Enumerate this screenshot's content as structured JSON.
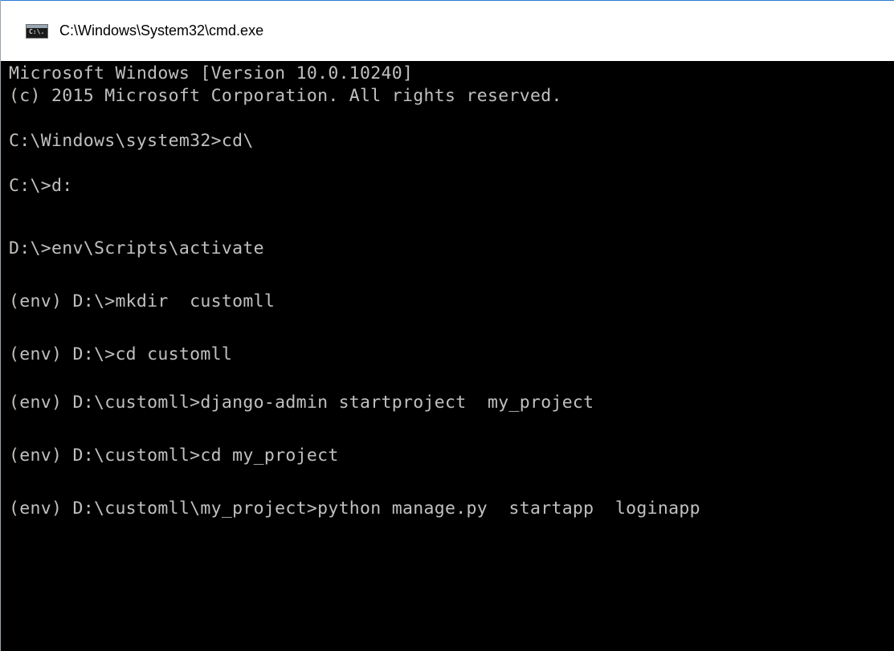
{
  "window": {
    "title": "C:\\Windows\\System32\\cmd.exe",
    "icon_text": "C:\\."
  },
  "console": {
    "lines": [
      "Microsoft Windows [Version 10.0.10240]",
      "(c) 2015 Microsoft Corporation. All rights reserved.",
      "",
      "C:\\Windows\\system32>cd\\",
      "",
      "C:\\>d:",
      "",
      "D:\\>env\\Scripts\\activate",
      "",
      "(env) D:\\>mkdir  customll",
      "",
      "(env) D:\\>cd customll",
      "",
      "(env) D:\\customll>django-admin startproject  my_project",
      "",
      "(env) D:\\customll>cd my_project",
      "",
      "(env) D:\\customll\\my_project>python manage.py  startapp  loginapp"
    ]
  },
  "colors": {
    "background": "#000000",
    "text": "#c0c0c0",
    "titlebar": "#ffffff",
    "accent": "#2b7bd5"
  }
}
